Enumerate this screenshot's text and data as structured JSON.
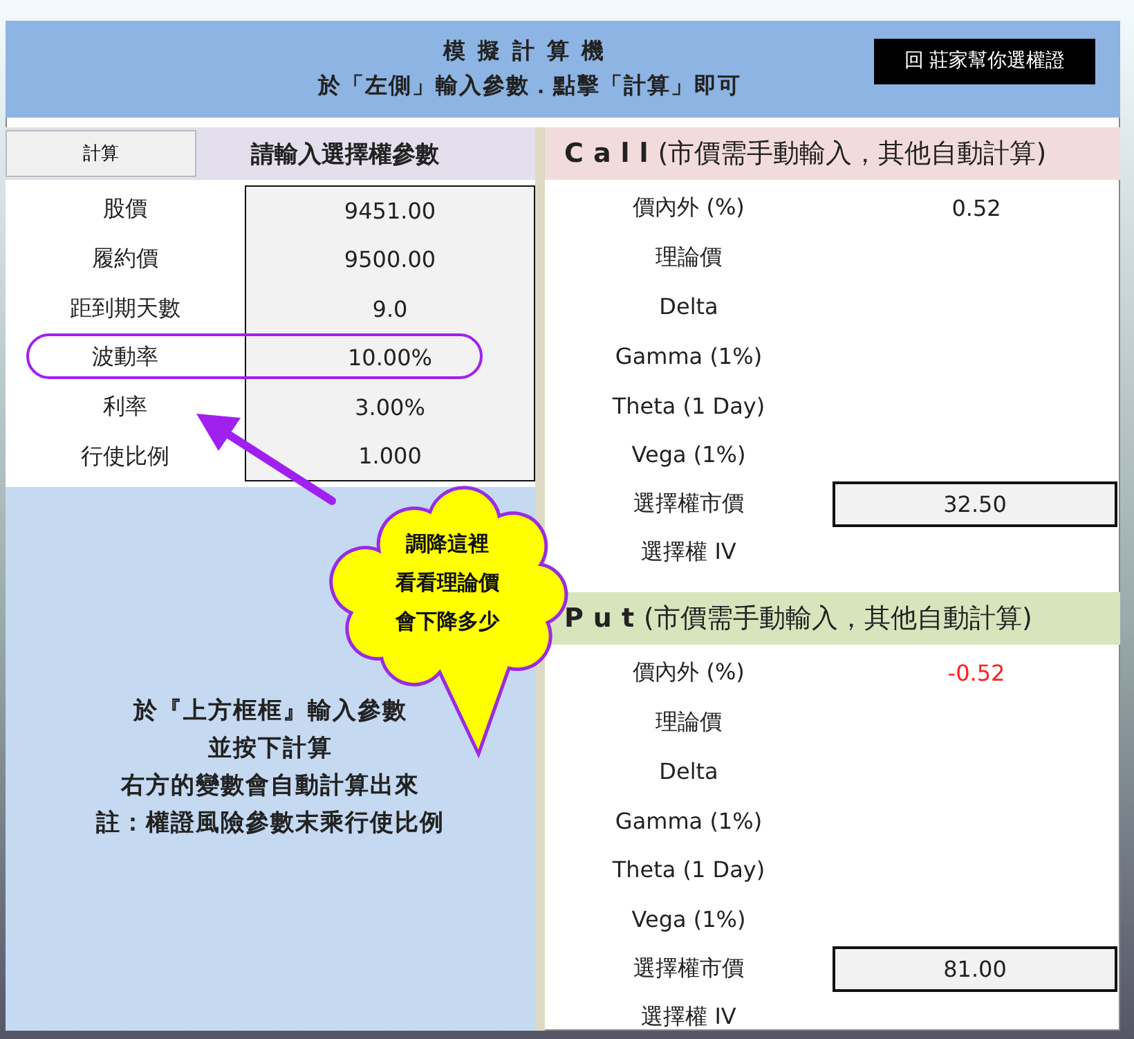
{
  "header": {
    "title": "模擬計算機",
    "subtitle": "於「左側」輸入參數．點擊「計算」即可",
    "link_button": "回 莊家幫你選權證"
  },
  "calc_button": "計算",
  "params_title": "請輸入選擇權參數",
  "params": [
    {
      "label": "股價",
      "value": "9451.00",
      "highlighted": false
    },
    {
      "label": "履約價",
      "value": "9500.00",
      "highlighted": false
    },
    {
      "label": "距到期天數",
      "value": "9.0",
      "highlighted": false
    },
    {
      "label": "波動率",
      "value": "10.00%",
      "highlighted": true
    },
    {
      "label": "利率",
      "value": "3.00%",
      "highlighted": false
    },
    {
      "label": "行使比例",
      "value": "1.000",
      "highlighted": false
    }
  ],
  "notes": [
    "於『上方框框』輸入參數",
    "並按下計算",
    "右方的變數會自動計算出來",
    "註：權證風險參數末乘行使比例"
  ],
  "call": {
    "kind": "call",
    "title": "**Call**(市價需手動輸入，其他自動計算)",
    "rows": [
      {
        "kind": "output",
        "label": "價內外 (%)",
        "value": "0.52",
        "negative": false
      },
      {
        "kind": "output",
        "label": "理論價"
      },
      {
        "kind": "output",
        "label": "Delta"
      },
      {
        "kind": "output",
        "label": "Gamma (1%)"
      },
      {
        "kind": "output",
        "label": "Theta (1 Day)"
      },
      {
        "kind": "output",
        "label": "Vega (1%)"
      },
      {
        "kind": "input",
        "label": "選擇權市價",
        "value": "32.50"
      },
      {
        "kind": "output",
        "label": "選擇權 IV"
      }
    ]
  },
  "put": {
    "kind": "put",
    "title": "**Put**(市價需手動輸入，其他自動計算)",
    "rows": [
      {
        "kind": "output",
        "label": "價內外 (%)",
        "value": "-0.52",
        "negative": true
      },
      {
        "kind": "output",
        "label": "理論價"
      },
      {
        "kind": "output",
        "label": "Delta"
      },
      {
        "kind": "output",
        "label": "Gamma (1%)"
      },
      {
        "kind": "output",
        "label": "Theta (1 Day)"
      },
      {
        "kind": "output",
        "label": "Vega (1%)"
      },
      {
        "kind": "input",
        "label": "選擇權市價",
        "value": "81.00"
      },
      {
        "kind": "output",
        "label": "選擇權 IV"
      }
    ]
  },
  "callout": {
    "lines": [
      "調降這裡",
      "看看理論價",
      "會下降多少"
    ]
  }
}
